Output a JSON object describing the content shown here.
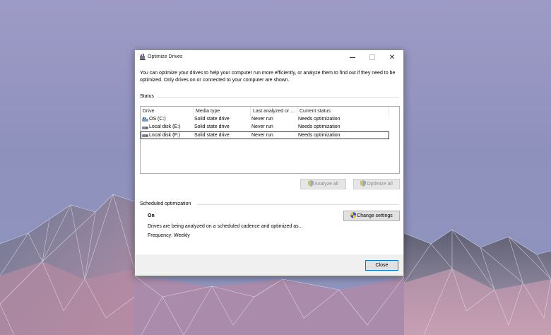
{
  "window": {
    "title": "Optimize Drives",
    "description": "You can optimize your drives to help your computer run more efficiently, or analyze them to find out if they need to be optimized. Only drives on or connected to your computer are shown."
  },
  "status": {
    "label": "Status",
    "columns": [
      "Drive",
      "Media type",
      "Last analyzed or ...",
      "Current status"
    ],
    "drives": [
      {
        "drive": "OS (C:)",
        "media_type": "Solid state drive",
        "last_analyzed": "Never run",
        "current_status": "Needs optimization",
        "icon": "windows-drive-icon"
      },
      {
        "drive": "Local disk (E:)",
        "media_type": "Solid state drive",
        "last_analyzed": "Never run",
        "current_status": "Needs optimization",
        "icon": "hard-drive-icon"
      },
      {
        "drive": "Local disk (F:)",
        "media_type": "Solid state drive",
        "last_analyzed": "Never run",
        "current_status": "Needs optimization",
        "icon": "hard-drive-icon",
        "selected": true
      }
    ],
    "analyze_all_label": "Analyze all",
    "optimize_all_label": "Optimize all"
  },
  "scheduled": {
    "label": "Scheduled optimization",
    "state": "On",
    "change_settings_label": "Change settings",
    "description": "Drives are being analyzed on a scheduled cadence and optimized as...",
    "frequency": "Frequency: Weekly"
  },
  "footer": {
    "close_label": "Close"
  },
  "colors": {
    "desktop_top": "#9d9bc6",
    "desktop_bottom": "#8e95bd",
    "focus_blue": "#0078d7",
    "button_face": "#e1e1e1"
  }
}
